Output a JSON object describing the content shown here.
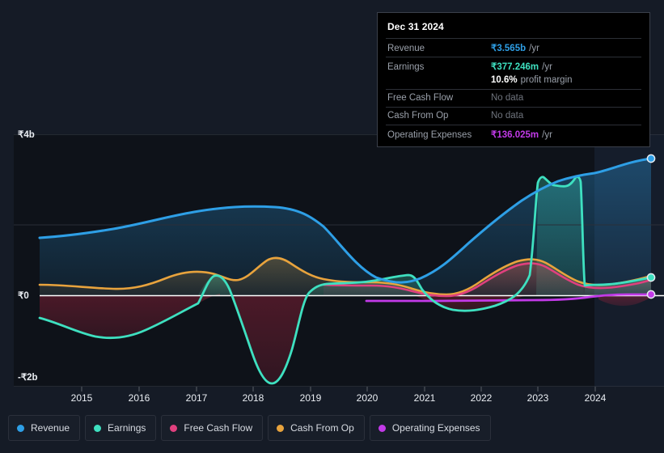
{
  "tooltip": {
    "title": "Dec 31 2024",
    "rows": [
      {
        "label": "Revenue",
        "value": "₹3.565b",
        "unit": "/yr",
        "color": "#2e9fe6",
        "nodata": false
      },
      {
        "label": "Earnings",
        "value": "₹377.246m",
        "unit": "/yr",
        "color": "#3ee0c0",
        "nodata": false
      },
      {
        "label": "",
        "value": "10.6%",
        "unit": "profit margin",
        "color": "#ffffff",
        "nodata": false
      },
      {
        "label": "Free Cash Flow",
        "value": "No data",
        "unit": "",
        "color": "#6f747d",
        "nodata": true
      },
      {
        "label": "Cash From Op",
        "value": "No data",
        "unit": "",
        "color": "#6f747d",
        "nodata": true
      },
      {
        "label": "Operating Expenses",
        "value": "₹136.025m",
        "unit": "/yr",
        "color": "#c23ae8",
        "nodata": false
      }
    ]
  },
  "legend": {
    "items": [
      {
        "label": "Revenue",
        "color": "#2e9fe6"
      },
      {
        "label": "Earnings",
        "color": "#3ee0c0"
      },
      {
        "label": "Free Cash Flow",
        "color": "#e0407e"
      },
      {
        "label": "Cash From Op",
        "color": "#e8a33d"
      },
      {
        "label": "Operating Expenses",
        "color": "#c23ae8"
      }
    ]
  },
  "chart_data": {
    "type": "area",
    "title": "",
    "xlabel": "",
    "ylabel": "",
    "currency": "₹",
    "grid": true,
    "legend_position": "bottom",
    "ylim": [
      -2000000000,
      4000000000
    ],
    "ytick_labels": [
      "₹4b",
      "₹0",
      "-₹2b"
    ],
    "ytick_values": [
      4000000000,
      0,
      -2000000000
    ],
    "xtick_labels": [
      "2015",
      "2016",
      "2017",
      "2018",
      "2019",
      "2020",
      "2021",
      "2022",
      "2023",
      "2024"
    ],
    "x": [
      2014.4,
      2015,
      2016,
      2017,
      2018,
      2019,
      2020,
      2021,
      2022,
      2023,
      2024,
      2024.8
    ],
    "forecast_band_start": "2024.3",
    "series": [
      {
        "name": "Revenue",
        "color": "#2e9fe6",
        "values": [
          1.42,
          1.5,
          1.64,
          1.82,
          1.9,
          1.92,
          1.88,
          0.4,
          1.05,
          2.55,
          3.1,
          3.565
        ],
        "unit": "b",
        "end_value": "₹3.565b"
      },
      {
        "name": "Earnings",
        "color": "#3ee0c0",
        "values": [
          -0.52,
          -0.72,
          -0.62,
          0.02,
          -1.88,
          -0.15,
          -0.1,
          -0.3,
          -0.05,
          2.7,
          -0.22,
          0.377
        ],
        "unit": "b",
        "end_value": "₹377.246m"
      },
      {
        "name": "Free Cash Flow",
        "color": "#e0407e",
        "values": [
          null,
          null,
          null,
          null,
          null,
          0.24,
          0.22,
          0.06,
          0.3,
          0.22,
          0.12,
          null
        ],
        "unit": "b",
        "end_value": "No data",
        "starts_at": "2019"
      },
      {
        "name": "Cash From Op",
        "color": "#e8a33d",
        "values": [
          0.1,
          0.08,
          0.18,
          0.12,
          0.4,
          0.26,
          0.24,
          0.07,
          0.34,
          0.26,
          0.16,
          null
        ],
        "unit": "b",
        "end_value": "No data"
      },
      {
        "name": "Operating Expenses",
        "color": "#c23ae8",
        "values": [
          null,
          null,
          null,
          null,
          null,
          null,
          0.02,
          0.02,
          0.02,
          0.03,
          0.09,
          0.136
        ],
        "unit": "b",
        "end_value": "₹136.025m",
        "starts_at": "2020"
      }
    ]
  }
}
